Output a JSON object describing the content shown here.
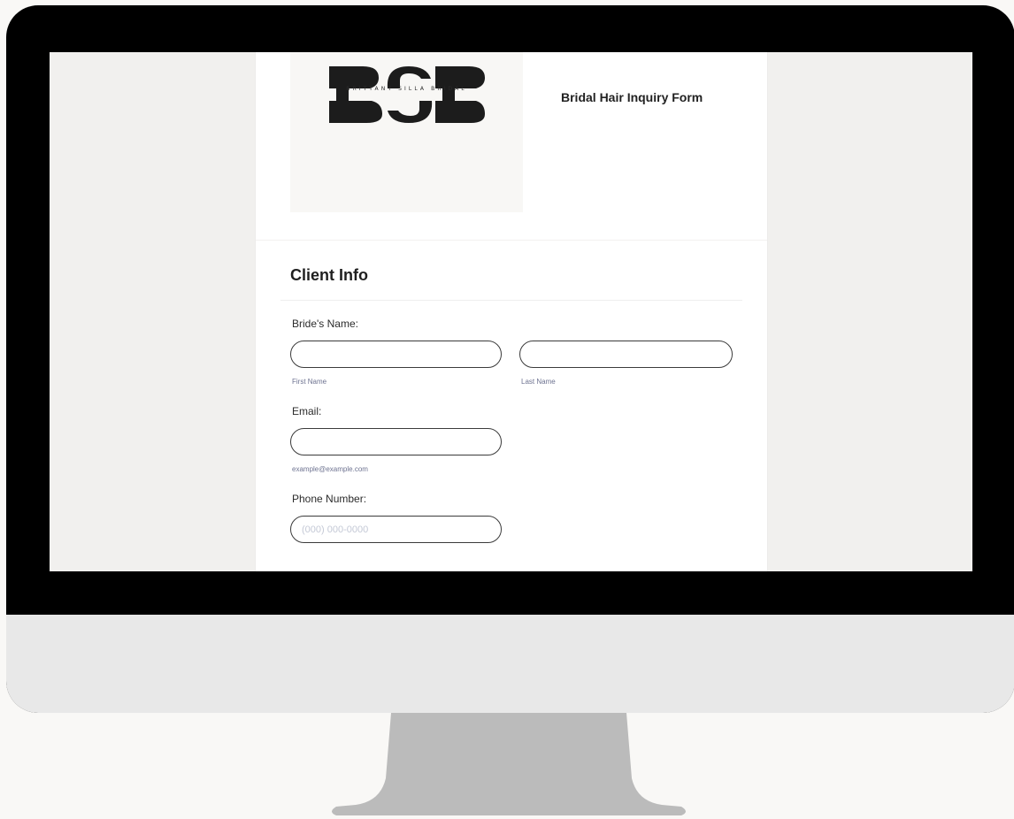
{
  "form": {
    "logo": {
      "letters": "BSB",
      "tagline": "BRITTANY SILLA BRIDAL"
    },
    "title": "Bridal Hair Inquiry Form",
    "section_title": "Client Info",
    "fields": {
      "brides_name": {
        "label": "Bride's Name:",
        "first_sublabel": "First Name",
        "last_sublabel": "Last Name",
        "first_value": "",
        "last_value": ""
      },
      "email": {
        "label": "Email:",
        "sublabel": "example@example.com",
        "value": ""
      },
      "phone": {
        "label": "Phone Number:",
        "placeholder": "(000) 000-0000",
        "value": ""
      }
    }
  },
  "colors": {
    "bezel": "#000000",
    "chin": "#e8e8e8",
    "stand": "#bbbbbb",
    "background": "#f9f8f6",
    "screen_background": "#f1f0ee",
    "sublabel": "#6e7391"
  }
}
